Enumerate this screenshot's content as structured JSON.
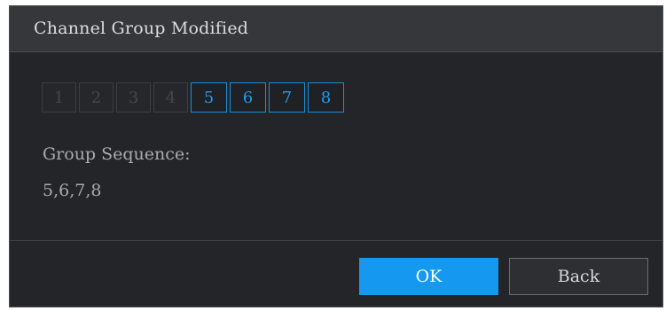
{
  "dialog": {
    "title": "Channel Group Modified"
  },
  "channels": [
    {
      "label": "1",
      "selected": false
    },
    {
      "label": "2",
      "selected": false
    },
    {
      "label": "3",
      "selected": false
    },
    {
      "label": "4",
      "selected": false
    },
    {
      "label": "5",
      "selected": true
    },
    {
      "label": "6",
      "selected": true
    },
    {
      "label": "7",
      "selected": true
    },
    {
      "label": "8",
      "selected": true
    }
  ],
  "sequence": {
    "label": "Group Sequence:",
    "value": "5,6,7,8"
  },
  "buttons": {
    "ok_label": "OK",
    "back_label": "Back"
  },
  "colors": {
    "accent": "#1598f0",
    "background": "#232528",
    "titlebar": "#35373b"
  }
}
